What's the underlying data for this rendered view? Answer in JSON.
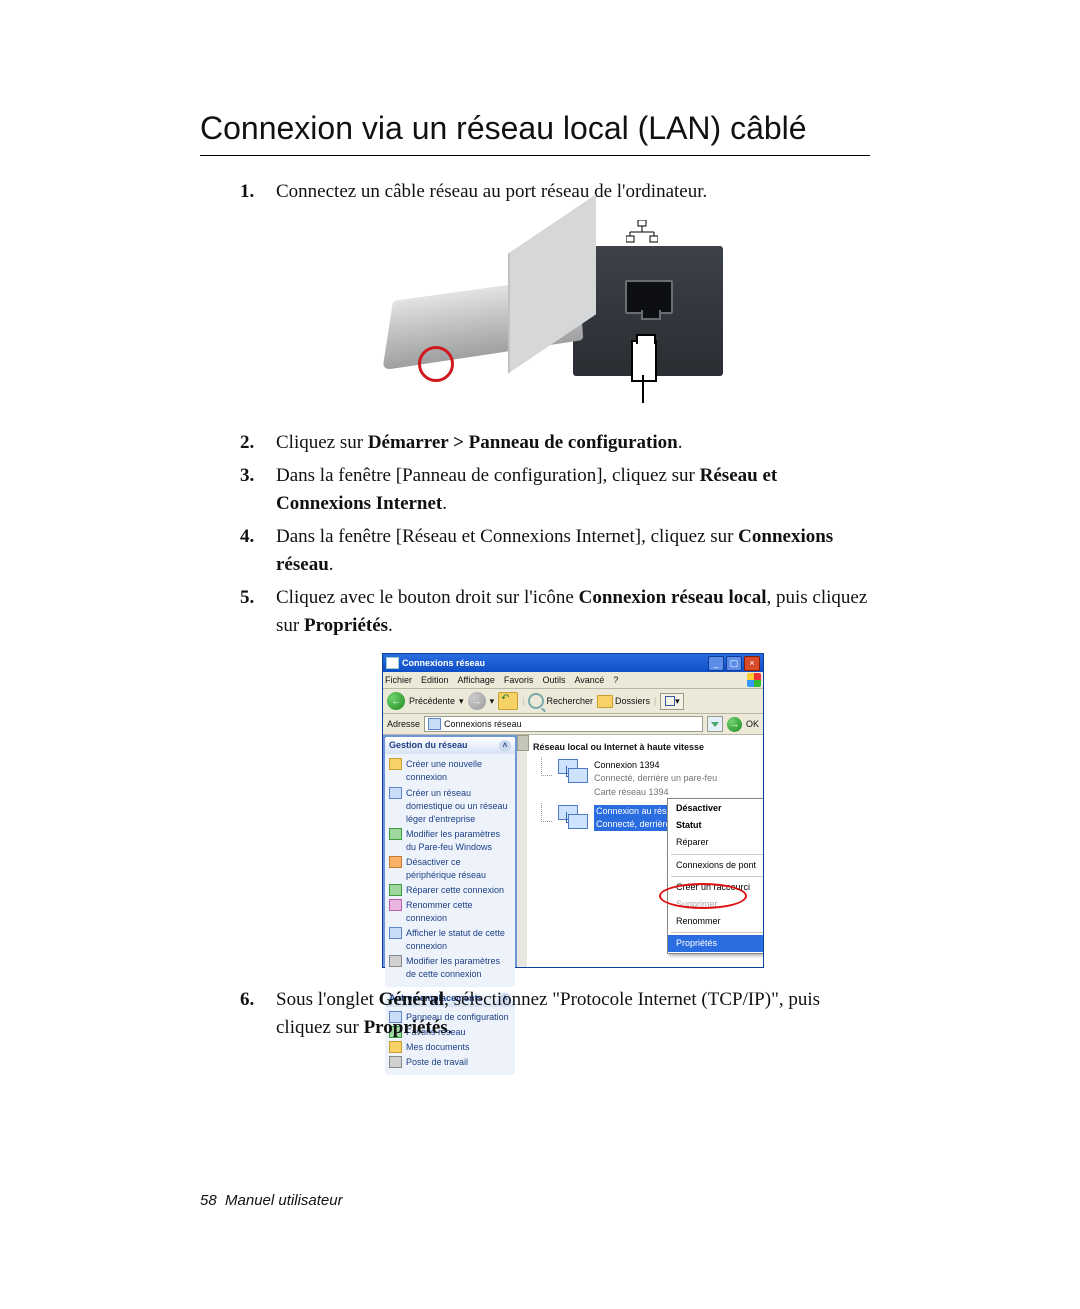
{
  "heading": "Connexion via un réseau local (LAN) câblé",
  "steps": {
    "s1": "Connectez un câble réseau au port réseau de l'ordinateur.",
    "s2_pre": "Cliquez sur ",
    "s2_bold": "Démarrer > Panneau de configuration",
    "s2_post": ".",
    "s3_pre": "Dans la fenêtre [Panneau de configuration], cliquez sur ",
    "s3_bold": "Réseau et Connexions Internet",
    "s3_post": ".",
    "s4_pre": "Dans la fenêtre [Réseau et Connexions Internet], cliquez sur ",
    "s4_bold": "Connexions réseau",
    "s4_post": ".",
    "s5_pre": "Cliquez avec le bouton droit sur l'icône ",
    "s5_bold": "Connexion réseau local",
    "s5_mid": ", puis cliquez sur ",
    "s5_bold2": "Propriétés",
    "s5_post": ".",
    "s6_pre": "Sous l'onglet ",
    "s6_bold": "Général",
    "s6_mid": ", sélectionnez \"Protocole Internet (TCP/IP)\", puis cliquez sur ",
    "s6_bold2": "Propriétés",
    "s6_post": "."
  },
  "xp": {
    "title": "Connexions réseau",
    "menus": [
      "Fichier",
      "Edition",
      "Affichage",
      "Favoris",
      "Outils",
      "Avancé",
      "?"
    ],
    "toolbar": {
      "back_label": "Précédente",
      "search_label": "Rechercher",
      "folders_label": "Dossiers"
    },
    "address": {
      "label": "Adresse",
      "value": "Connexions réseau",
      "ok": "OK"
    },
    "sidebar": {
      "panel1_title": "Gestion du réseau",
      "tasks": [
        "Créer une nouvelle connexion",
        "Créer un réseau domestique ou un réseau léger d'entreprise",
        "Modifier les paramètres du Pare-feu Windows",
        "Désactiver ce périphérique réseau",
        "Réparer cette connexion",
        "Renommer cette connexion",
        "Afficher le statut de cette connexion",
        "Modifier les paramètres de cette connexion"
      ],
      "panel2_title": "Autres emplacements",
      "places": [
        "Panneau de configuration",
        "Favoris réseau",
        "Mes documents",
        "Poste de travail"
      ]
    },
    "content": {
      "category": "Réseau local ou Internet à haute vitesse",
      "conn1_name": "Connexion 1394",
      "conn1_sub1": "Connecté, derrière un pare-feu",
      "conn1_sub2": "Carte réseau 1394",
      "conn2_name": "Connexion au réseau local",
      "conn2_sub1": "Connecté, derrière un pare-feu",
      "context_menu": [
        {
          "label": "Désactiver",
          "type": "bold"
        },
        {
          "label": "Statut",
          "type": "bold"
        },
        {
          "label": "Réparer",
          "type": "reg"
        },
        {
          "type": "sep"
        },
        {
          "label": "Connexions de pont",
          "type": "reg"
        },
        {
          "type": "sep"
        },
        {
          "label": "Créer un raccourci",
          "type": "reg"
        },
        {
          "label": "Supprimer",
          "type": "dis"
        },
        {
          "label": "Renommer",
          "type": "reg"
        },
        {
          "type": "sep"
        },
        {
          "label": "Propriétés",
          "type": "hl"
        }
      ]
    }
  },
  "footer_page": "58",
  "footer_text": "Manuel utilisateur"
}
